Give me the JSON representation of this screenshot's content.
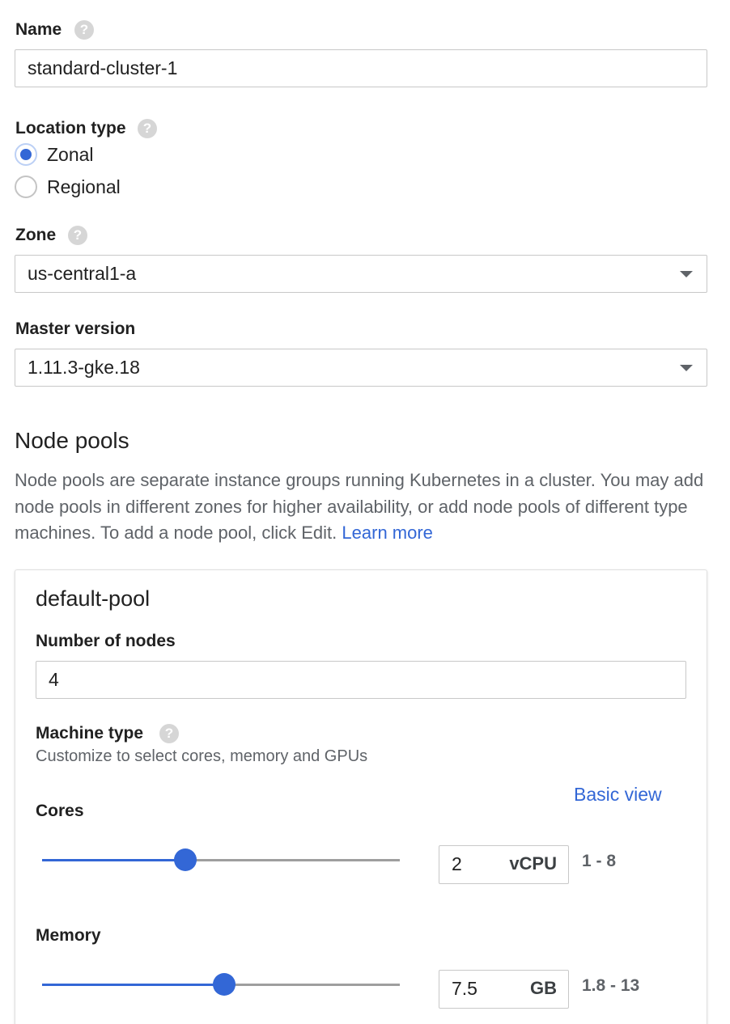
{
  "name": {
    "label": "Name",
    "help_icon": "help-icon",
    "value": "standard-cluster-1"
  },
  "location_type": {
    "label": "Location type",
    "help_icon": "help-icon",
    "options": [
      {
        "label": "Zonal",
        "selected": true
      },
      {
        "label": "Regional",
        "selected": false
      }
    ]
  },
  "zone": {
    "label": "Zone",
    "help_icon": "help-icon",
    "value": "us-central1-a"
  },
  "master_version": {
    "label": "Master version",
    "value": "1.11.3-gke.18"
  },
  "node_pools": {
    "heading": "Node pools",
    "description": "Node pools are separate instance groups running Kubernetes in a cluster. You may add node pools in different zones for higher availability, or add node pools of different type machines. To add a node pool, click Edit.",
    "learn_more": "Learn more"
  },
  "default_pool": {
    "title": "default-pool",
    "num_nodes_label": "Number of nodes",
    "num_nodes_value": "4",
    "machine_type_label": "Machine type",
    "machine_type_help": "Customize to select cores, memory and GPUs",
    "basic_view": "Basic view",
    "cores": {
      "label": "Cores",
      "value": "2",
      "unit": "vCPU",
      "range": "1 - 8",
      "min": 1,
      "max": 8,
      "fraction": 0.4
    },
    "memory": {
      "label": "Memory",
      "value": "7.5",
      "unit": "GB",
      "range": "1.8 - 13",
      "min": 1.8,
      "max": 13,
      "fraction": 0.51
    }
  },
  "colors": {
    "accent": "#3367d6",
    "border": "#c8c8c8",
    "muted": "#5f6368"
  }
}
